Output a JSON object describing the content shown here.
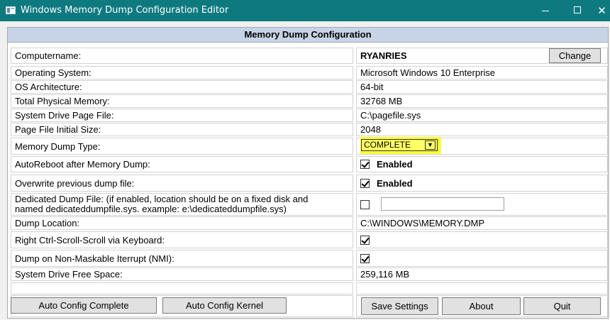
{
  "window": {
    "title": "Windows Memory Dump Configuration Editor",
    "minimize": "—",
    "close": "✕"
  },
  "header": {
    "title": "Memory Dump Configuration"
  },
  "computer": {
    "label": "Computername:",
    "value": "RYANRIES",
    "change_button": "Change"
  },
  "rows": [
    {
      "label": "Operating System:",
      "value": "Microsoft Windows 10 Enterprise"
    },
    {
      "label": "OS Architecture:",
      "value": "64-bit"
    },
    {
      "label": "Total Physical Memory:",
      "value": "32768 MB"
    },
    {
      "label": "System Drive Page File:",
      "value": "C:\\pagefile.sys"
    },
    {
      "label": "Page File Initial Size:",
      "value": "2048"
    }
  ],
  "dump_type": {
    "label": "Memory Dump Type:",
    "value": "COMPLETE"
  },
  "autoreboot": {
    "label": "AutoReboot after Memory Dump:",
    "checked": true,
    "text": "Enabled"
  },
  "overwrite": {
    "label": "Overwrite previous dump file:",
    "checked": true,
    "text": "Enabled"
  },
  "dedicated": {
    "label": "Dedicated Dump File: (if enabled, location should be on a fixed disk and\nnamed dedicateddumpfile.sys. example: e:\\dedicateddumpfile.sys)",
    "checked": false,
    "value": ""
  },
  "dump_location": {
    "label": "Dump Location:",
    "value": "C:\\WINDOWS\\MEMORY.DMP"
  },
  "ctrl_scroll": {
    "label": "Right Ctrl-Scroll-Scroll via Keyboard:",
    "checked": true
  },
  "nmi": {
    "label": "Dump on Non-Maskable Iterrupt (NMI):",
    "checked": true
  },
  "free_space": {
    "label": "System Drive Free Space:",
    "value": "259,116 MB"
  },
  "buttons": {
    "auto_complete": "Auto Config Complete",
    "auto_kernel": "Auto Config Kernel",
    "save": "Save Settings",
    "about": "About",
    "quit": "Quit"
  },
  "colors": {
    "titlebar": "#0e7a80",
    "header": "#c7d3e6",
    "highlight": "#ffff33"
  }
}
